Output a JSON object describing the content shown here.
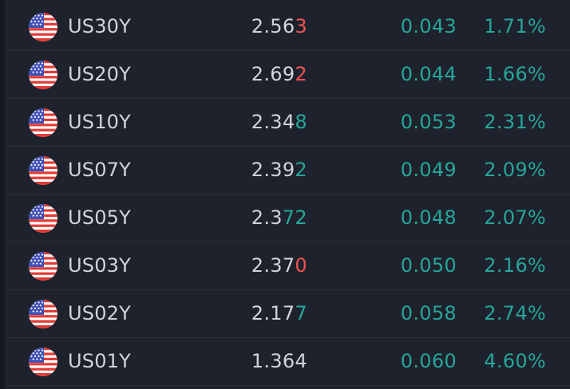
{
  "colors": {
    "background": "#1e222d",
    "divider": "#2a2e39",
    "text": "#d1d4dc",
    "up": "#26a69a",
    "down": "#ef5350"
  },
  "rows": [
    {
      "symbol": "US30Y",
      "flag_icon": "us-flag-icon",
      "last_base": "2.56",
      "last_tick": "3",
      "tick_direction": "down",
      "change": "0.043",
      "change_percent": "1.71%"
    },
    {
      "symbol": "US20Y",
      "flag_icon": "us-flag-icon",
      "last_base": "2.69",
      "last_tick": "2",
      "tick_direction": "down",
      "change": "0.044",
      "change_percent": "1.66%"
    },
    {
      "symbol": "US10Y",
      "flag_icon": "us-flag-icon",
      "last_base": "2.34",
      "last_tick": "8",
      "tick_direction": "up",
      "change": "0.053",
      "change_percent": "2.31%"
    },
    {
      "symbol": "US07Y",
      "flag_icon": "us-flag-icon",
      "last_base": "2.39",
      "last_tick": "2",
      "tick_direction": "up",
      "change": "0.049",
      "change_percent": "2.09%"
    },
    {
      "symbol": "US05Y",
      "flag_icon": "us-flag-icon",
      "last_base": "2.3",
      "last_tick": "72",
      "tick_direction": "up",
      "change": "0.048",
      "change_percent": "2.07%"
    },
    {
      "symbol": "US03Y",
      "flag_icon": "us-flag-icon",
      "last_base": "2.37",
      "last_tick": "0",
      "tick_direction": "down",
      "change": "0.050",
      "change_percent": "2.16%"
    },
    {
      "symbol": "US02Y",
      "flag_icon": "us-flag-icon",
      "last_base": "2.17",
      "last_tick": "7",
      "tick_direction": "up",
      "change": "0.058",
      "change_percent": "2.74%"
    },
    {
      "symbol": "US01Y",
      "flag_icon": "us-flag-icon",
      "last_base": "1.364",
      "last_tick": "",
      "tick_direction": "none",
      "change": "0.060",
      "change_percent": "4.60%"
    }
  ]
}
